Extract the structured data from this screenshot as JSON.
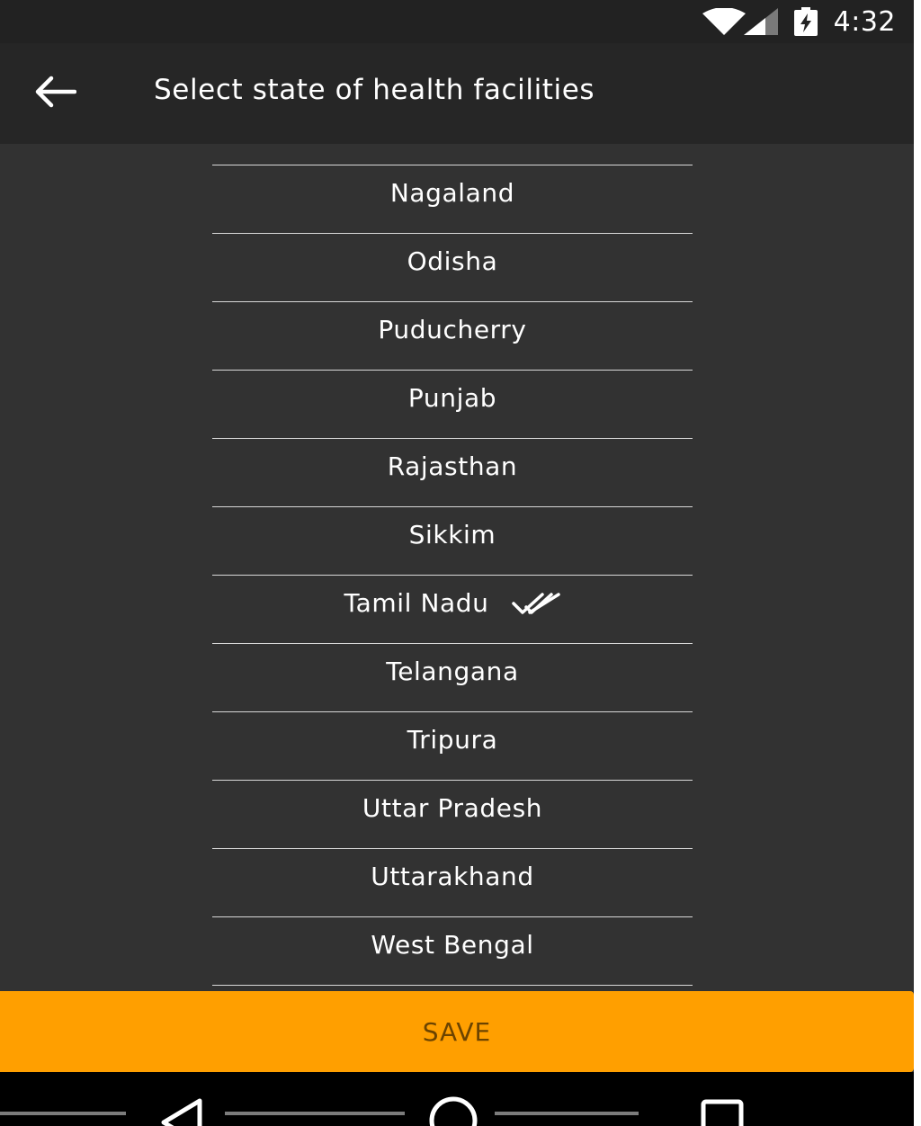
{
  "status_bar": {
    "time": "4:32",
    "icons": [
      "wifi-icon",
      "cellular-signal-icon",
      "battery-charging-icon"
    ]
  },
  "toolbar": {
    "back_icon": "arrow-left-icon",
    "title": "Select state of health facilities"
  },
  "states": [
    {
      "label": "Nagaland",
      "selected": false
    },
    {
      "label": "Odisha",
      "selected": false
    },
    {
      "label": "Puducherry",
      "selected": false
    },
    {
      "label": "Punjab",
      "selected": false
    },
    {
      "label": "Rajasthan",
      "selected": false
    },
    {
      "label": "Sikkim",
      "selected": false
    },
    {
      "label": "Tamil Nadu",
      "selected": true
    },
    {
      "label": "Telangana",
      "selected": false
    },
    {
      "label": "Tripura",
      "selected": false
    },
    {
      "label": "Uttar Pradesh",
      "selected": false
    },
    {
      "label": "Uttarakhand",
      "selected": false
    },
    {
      "label": "West Bengal",
      "selected": false
    }
  ],
  "selected_icon": "double-check-icon",
  "save_button": {
    "label": "SAVE"
  },
  "nav_bar": {
    "icons": [
      "back-triangle-icon",
      "home-circle-icon",
      "recents-square-icon"
    ]
  },
  "colors": {
    "background": "#323232",
    "toolbar": "#262626",
    "status_bar": "#222222",
    "accent": "#ff9f00",
    "save_text": "#6b4300",
    "divider": "#d8d8d8",
    "text": "#ffffff"
  }
}
